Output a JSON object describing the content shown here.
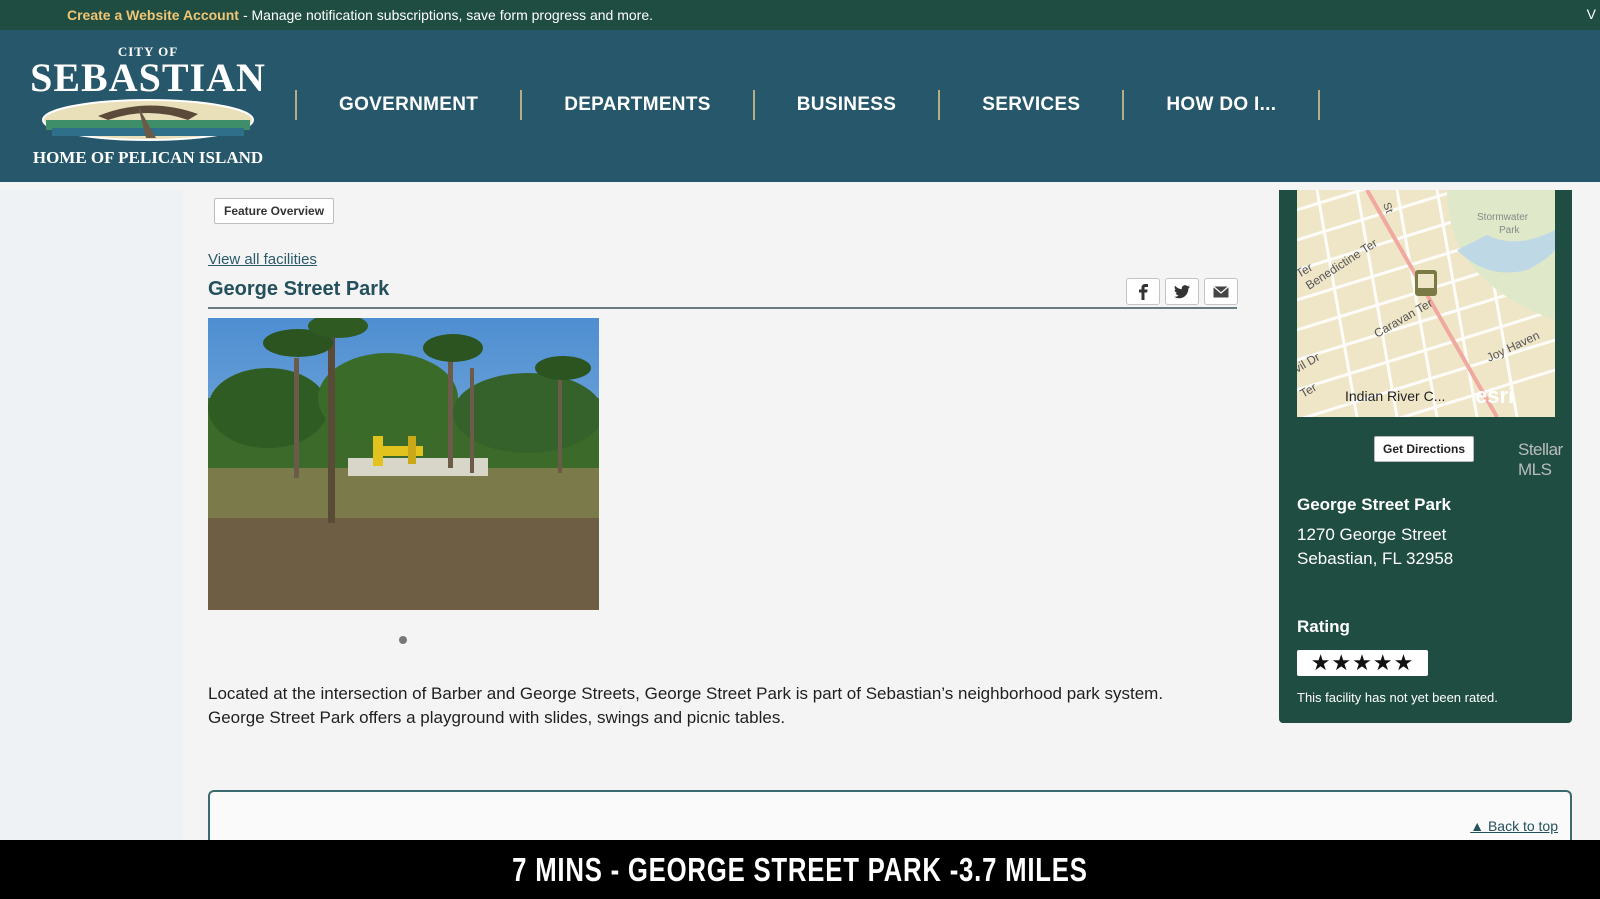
{
  "topbar": {
    "accent_text": "Create a Website Account",
    "text": "- Manage notification subscriptions, save form progress and more.",
    "edge_char": "V"
  },
  "logo": {
    "city_of": "CITY OF",
    "name": "SEBASTIAN",
    "tagline": "HOME OF PELICAN ISLAND"
  },
  "nav": {
    "items": [
      {
        "label": "GOVERNMENT"
      },
      {
        "label": "DEPARTMENTS"
      },
      {
        "label": "BUSINESS"
      },
      {
        "label": "SERVICES"
      },
      {
        "label": "HOW DO I..."
      }
    ]
  },
  "main": {
    "feature_overview": "Feature Overview",
    "view_all": "View all facilities",
    "title": "George Street Park",
    "share_icons": [
      "facebook-icon",
      "twitter-icon",
      "email-icon"
    ],
    "description": "Located at the intersection of Barber and George Streets, George Street Park is part of Sebastian’s neighborhood park system. George Street Park offers a playground with slides, swings and picnic tables.",
    "back_to_top": "▲ Back to top"
  },
  "map": {
    "labels": {
      "stormwater": "Stormwater",
      "park": "Park",
      "benedictine": "Benedictine Ter",
      "caravan": "Caravan Ter",
      "joy_haven": "Joy Haven",
      "ter_left": "Ter",
      "dr_left": "vil Dr",
      "ter_bottom": "Ter",
      "st_top": "St",
      "county": "Indian River C...",
      "esri": "esri"
    }
  },
  "sidebar": {
    "directions": "Get Directions",
    "name": "George Street Park",
    "address_line1": "1270 George Street",
    "address_line2": "Sebastian, FL 32958",
    "rating_label": "Rating",
    "stars": "★★★★★",
    "rating_note": "This facility has not yet been rated."
  },
  "watermark": "Stellar MLS",
  "caption": "7 MINS - GEORGE STREET PARK -3.7 MILES",
  "colors": {
    "topbar": "#1f4d41",
    "header": "#26576b",
    "sidebar": "#1f4d41",
    "link": "#2b5a68",
    "accent": "#f0c674"
  }
}
